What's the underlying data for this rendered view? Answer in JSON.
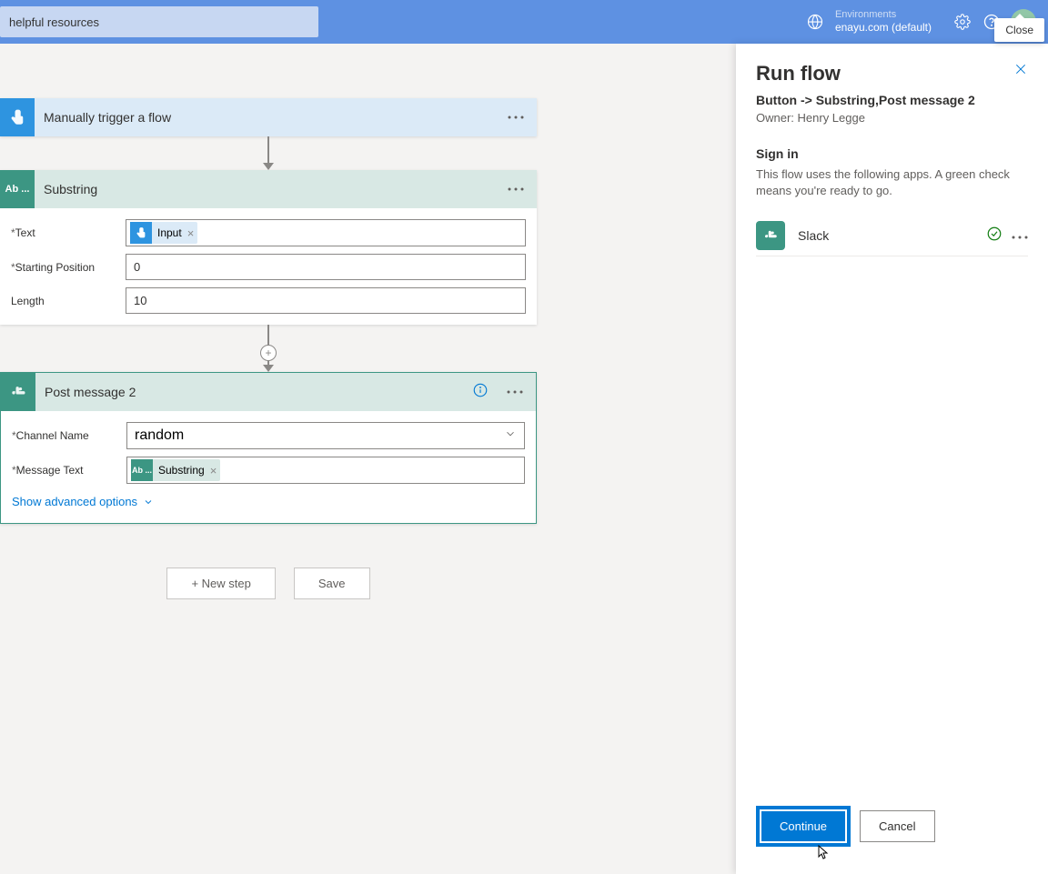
{
  "header": {
    "search_placeholder": "helpful resources",
    "env_label": "Environments",
    "env_value": "enayu.com (default)"
  },
  "tooltip": {
    "close": "Close"
  },
  "flow": {
    "trigger": {
      "title": "Manually trigger a flow"
    },
    "substring": {
      "title": "Substring",
      "icon_text": "Ab ...",
      "params": {
        "text_label": "Text",
        "text_token": "Input",
        "starting_label": "Starting Position",
        "starting_value": "0",
        "length_label": "Length",
        "length_value": "10"
      }
    },
    "slack": {
      "title": "Post message 2",
      "params": {
        "channel_label": "Channel Name",
        "channel_value": "random",
        "message_label": "Message Text",
        "message_token": "Substring"
      },
      "advanced": "Show advanced options"
    },
    "actions": {
      "new_step": "+ New step",
      "save": "Save"
    }
  },
  "panel": {
    "title": "Run flow",
    "subtitle": "Button -> Substring,Post message 2",
    "owner": "Owner: Henry Legge",
    "signin": "Sign in",
    "desc": "This flow uses the following apps. A green check means you're ready to go.",
    "app": {
      "name": "Slack"
    },
    "footer": {
      "continue": "Continue",
      "cancel": "Cancel"
    }
  }
}
